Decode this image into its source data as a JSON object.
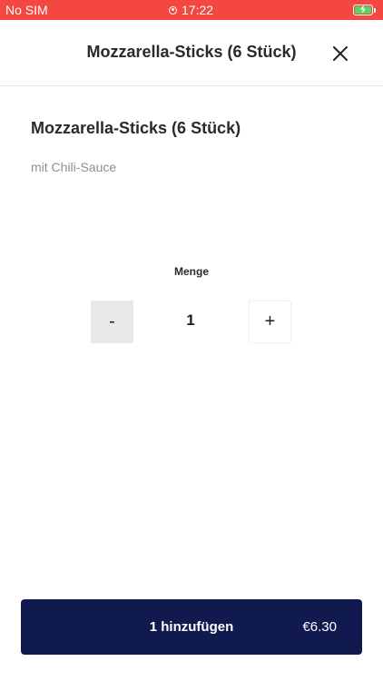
{
  "status_bar": {
    "carrier": "No SIM",
    "time": "17:22",
    "background_color": "#f4473f",
    "battery_color": "#4cd964",
    "icons": [
      "recording-icon",
      "battery-charging-icon"
    ]
  },
  "header": {
    "title": "Mozzarella-Sticks (6 Stück)",
    "close_icon": "close-icon"
  },
  "product": {
    "name": "Mozzarella-Sticks (6 Stück)",
    "description": "mit Chili-Sauce"
  },
  "quantity": {
    "label": "Menge",
    "value": "1",
    "decrement_label": "-",
    "increment_label": "+"
  },
  "add_button": {
    "label": "1 hinzufügen",
    "price": "€6.30",
    "background_color": "#111a4f"
  }
}
